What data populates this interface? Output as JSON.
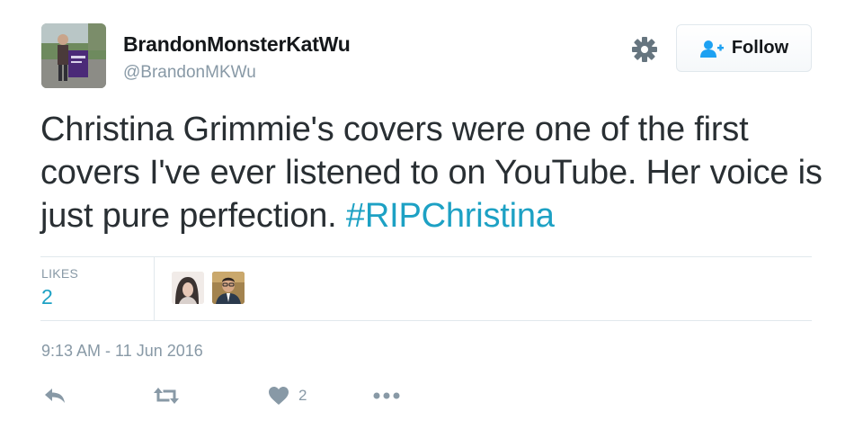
{
  "user": {
    "display_name": "BrandonMonsterKatWu",
    "screen_name": "@BrandonMKWu",
    "avatar_icon": "user-avatar"
  },
  "header": {
    "settings_icon": "gear-icon",
    "follow_label": "Follow",
    "follow_icon": "add-user-icon"
  },
  "tweet": {
    "text": "Christina Grimmie's covers were one of the first covers I've ever listened to on YouTube. Her voice is just pure perfection.",
    "hashtag": "#RIPChristina"
  },
  "stats": {
    "likes_label": "LIKES",
    "likes_count": "2"
  },
  "timestamp": "9:13 AM - 11 Jun 2016",
  "actions": {
    "reply_icon": "reply-icon",
    "retweet_icon": "retweet-icon",
    "like_icon": "heart-icon",
    "like_count": "2",
    "more_icon": "more-icon"
  },
  "colors": {
    "link": "#1da1c4",
    "muted": "#8899a6",
    "text": "#292f33",
    "border": "#e1e8ed"
  }
}
